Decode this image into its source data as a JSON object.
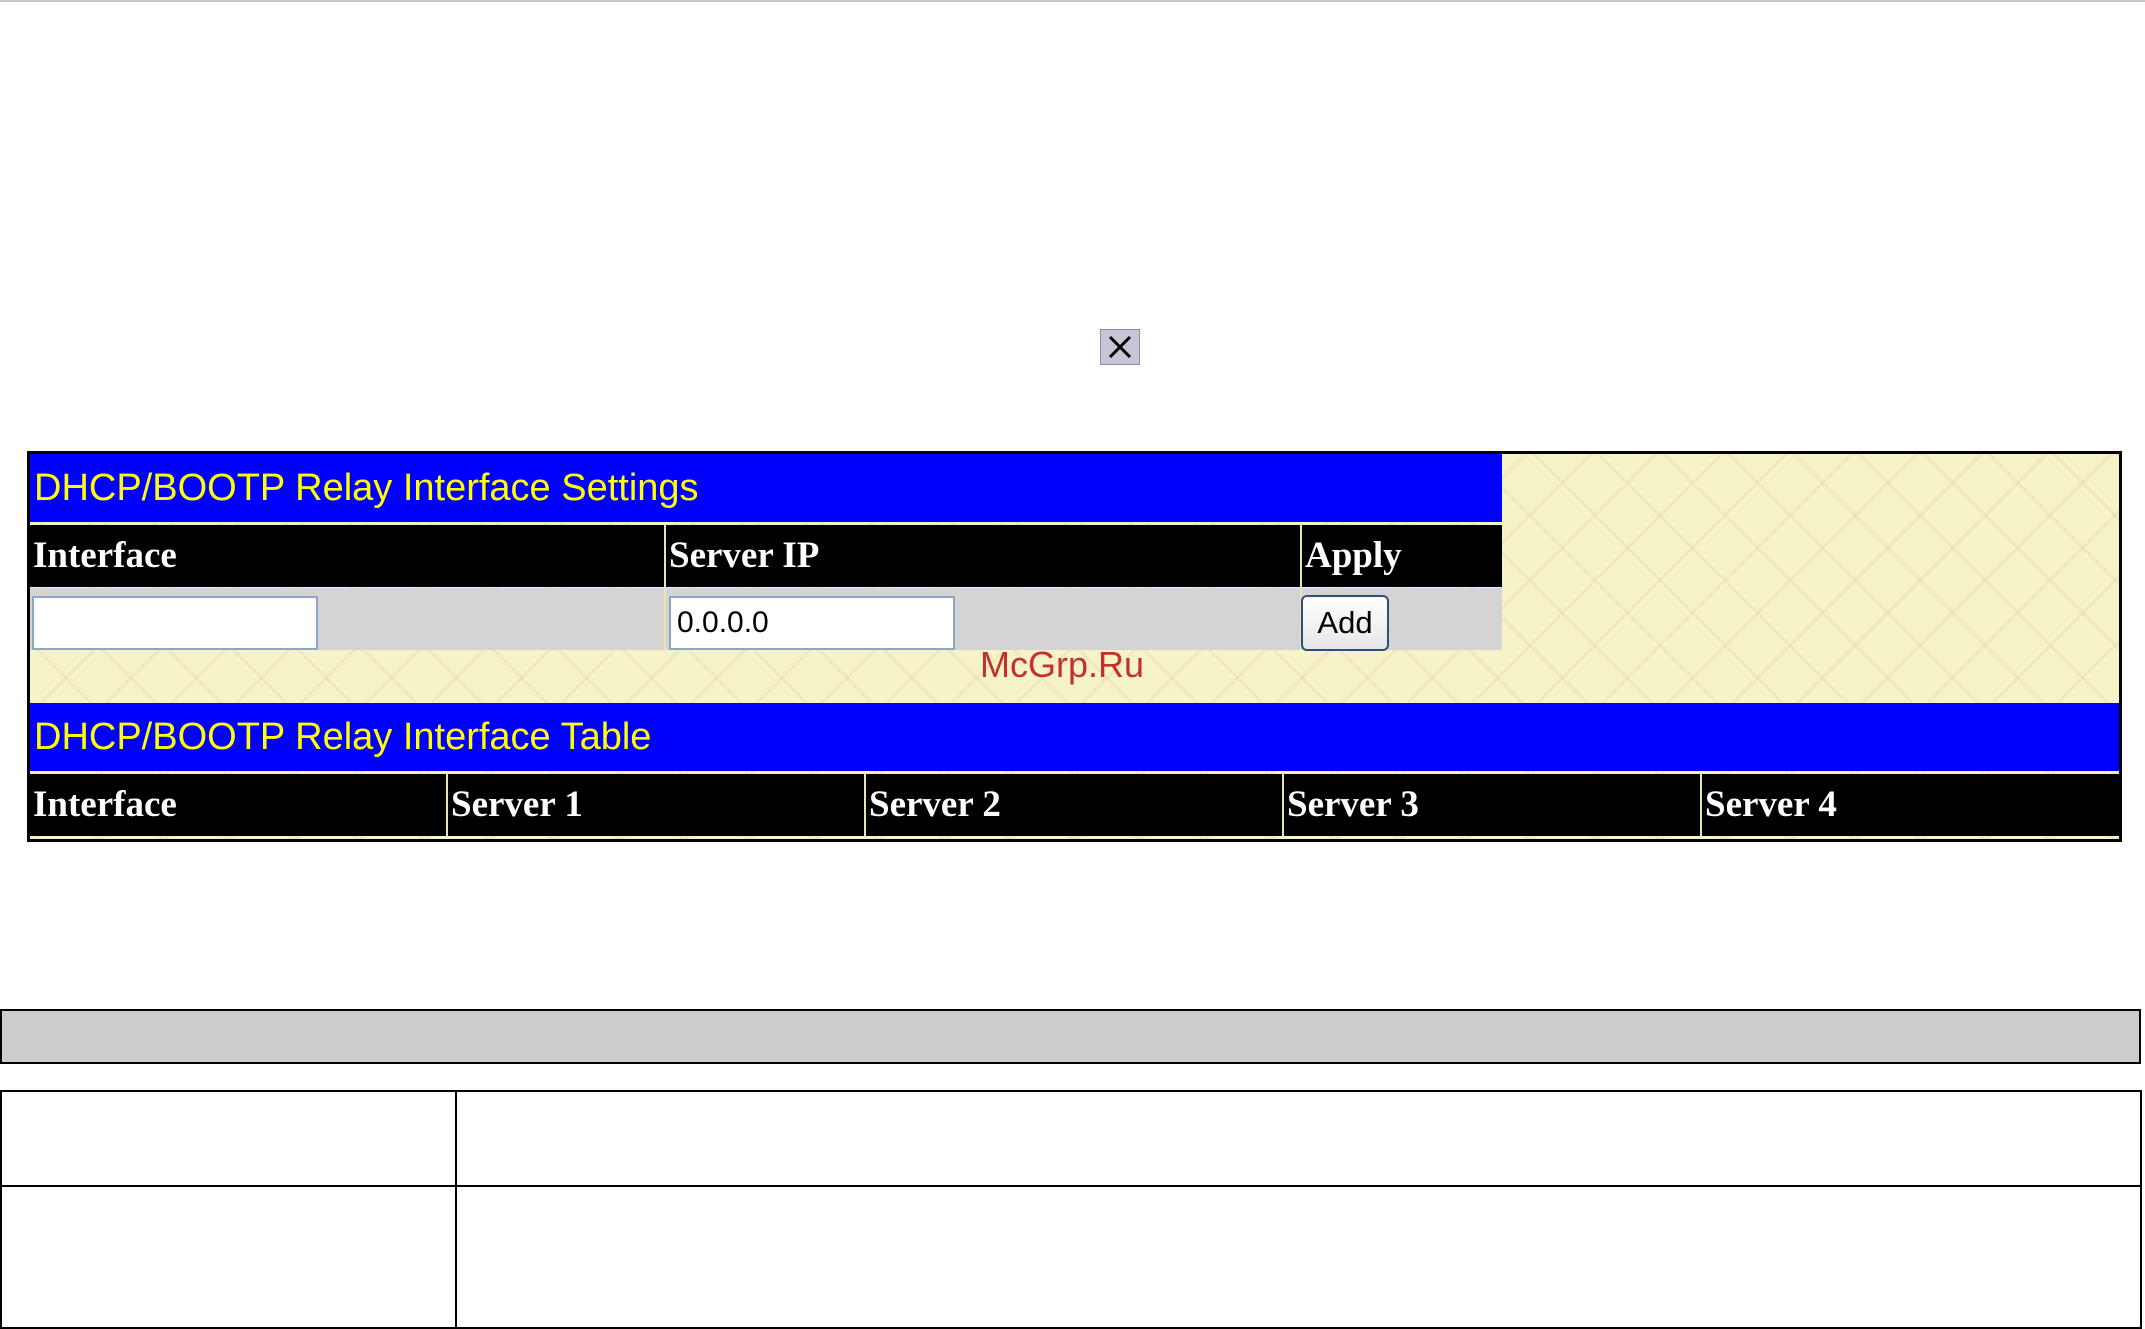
{
  "settings": {
    "title": "DHCP/BOOTP Relay Interface Settings",
    "columns": [
      "Interface",
      "Server IP",
      "Apply"
    ],
    "interface_value": "",
    "server_ip_value": "0.0.0.0",
    "add_label": "Add"
  },
  "table": {
    "title": "DHCP/BOOTP Relay Interface Table",
    "columns": [
      "Interface",
      "Server 1",
      "Server 2",
      "Server 3",
      "Server 4"
    ]
  },
  "watermark": "McGrp.Ru",
  "icons": {
    "close": "close-icon"
  },
  "colors": {
    "title_bar": "#0000ff",
    "title_text": "#ffff00",
    "header_bg": "#000000",
    "header_text": "#ffffff",
    "panel_bg": "#f7f3c8"
  }
}
